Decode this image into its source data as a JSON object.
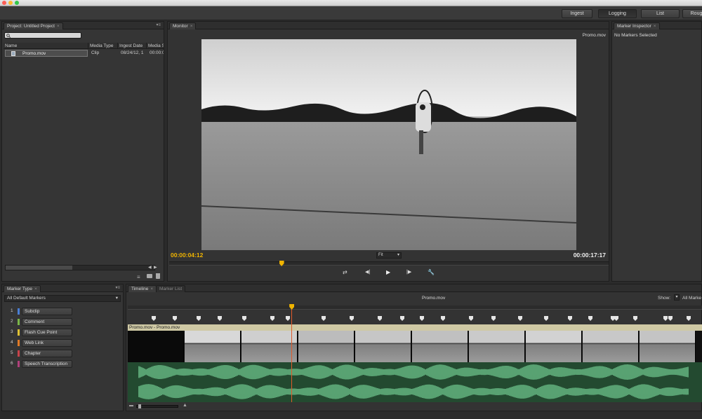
{
  "window": {
    "traffic_colors": [
      "#fc5f57",
      "#fdbc2e",
      "#34c84a"
    ]
  },
  "workspaces": [
    {
      "label": "Ingest",
      "active": false
    },
    {
      "label": "Logging",
      "active": true
    },
    {
      "label": "List",
      "active": false
    },
    {
      "label": "Roug",
      "active": false
    }
  ],
  "project_panel": {
    "tab": "Project: Untitled Project",
    "columns": [
      "Name",
      "Media Type",
      "Ingest Date",
      "Media S"
    ],
    "rows": [
      {
        "name": "Promo.mov",
        "type": "Clip",
        "date": "08/24/12, 1",
        "media": "00:00:0"
      }
    ]
  },
  "monitor": {
    "tab": "Monitor",
    "clip_name": "Promo.mov",
    "current_time": "00:00:04:12",
    "duration": "00:00:17:17",
    "zoom": "Fit",
    "playhead_fraction": 0.255,
    "accent_color": "#f0b400"
  },
  "marker_inspector": {
    "tab": "Marker Inspector",
    "status": "No Markers Selected"
  },
  "marker_type": {
    "tab": "Marker Type",
    "set": "All Default Markers",
    "items": [
      {
        "num": "1",
        "label": "Subclip",
        "color": "#4a7fd6"
      },
      {
        "num": "2",
        "label": "Comment",
        "color": "#7ab648"
      },
      {
        "num": "3",
        "label": "Flash Cue Point",
        "color": "#e0c234"
      },
      {
        "num": "4",
        "label": "Web Link",
        "color": "#e07a26"
      },
      {
        "num": "5",
        "label": "Chapter",
        "color": "#c8434a"
      },
      {
        "num": "6",
        "label": "Speech Transcription",
        "color": "#b0407a"
      }
    ]
  },
  "timeline": {
    "tabs": [
      "Timeline",
      "Marker List"
    ],
    "clip_title": "Promo.mov",
    "show_label": "Show:",
    "show_value": "All Marke",
    "track_label": "Promo.mov - Promo.mov",
    "playhead_fraction": 0.285,
    "waveform_color": "#7ddc9e"
  },
  "icons": [
    "search-icon",
    "clip-icon",
    "list-view-icon",
    "folder-icon",
    "trash-icon",
    "loop-icon",
    "step-back-icon",
    "play-icon",
    "step-forward-icon",
    "wrench-icon",
    "panel-menu-icon",
    "marker-icon",
    "zoom-out-icon",
    "zoom-in-icon"
  ]
}
